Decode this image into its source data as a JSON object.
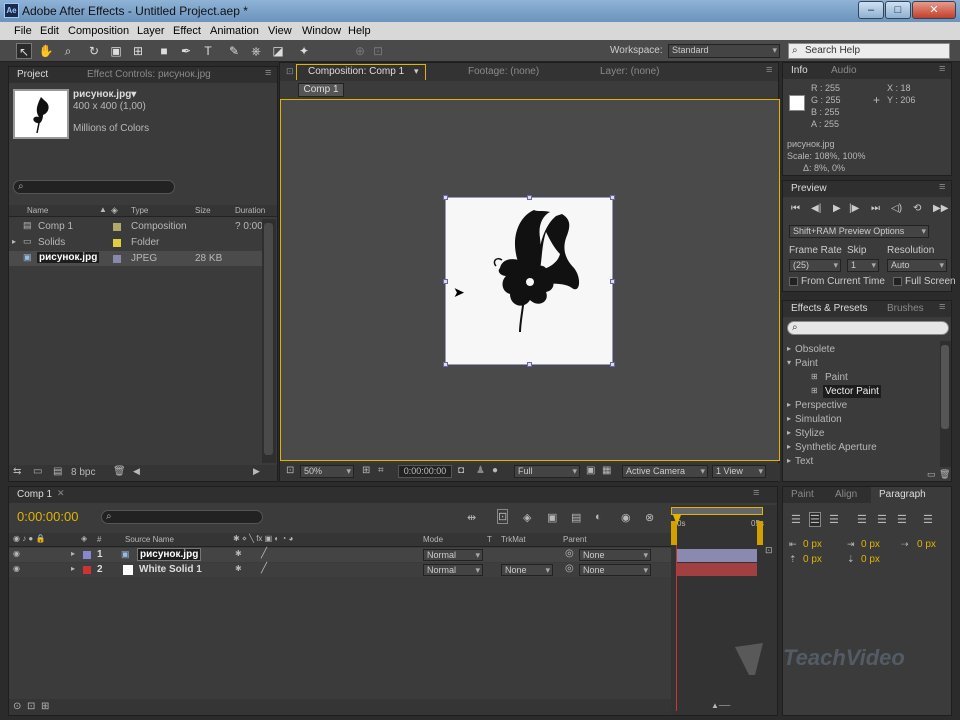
{
  "window": {
    "title": "Adobe After Effects - Untitled Project.aep *",
    "app_icon": "Ae"
  },
  "menu": [
    "File",
    "Edit",
    "Composition",
    "Layer",
    "Effect",
    "Animation",
    "View",
    "Window",
    "Help"
  ],
  "toolbar": {
    "workspace_label": "Workspace:",
    "workspace_value": "Standard",
    "search_placeholder": "Search Help",
    "search_icon": "search-icon"
  },
  "project": {
    "tabs": [
      "Project",
      "Effect Controls: рисунок.jpg"
    ],
    "thumb": {
      "name": "рисунок.jpg▾",
      "dims": "400 x 400 (1,00)",
      "colors": "Millions of Colors"
    },
    "columns": [
      "Name",
      "Type",
      "Size",
      "Duration"
    ],
    "items": [
      {
        "name": "Comp 1",
        "type": "Composition",
        "size": "",
        "duration": "? 0:00",
        "color": "#b3a96a"
      },
      {
        "name": "Solids",
        "type": "Folder",
        "size": "",
        "duration": "",
        "color": "#e0d040"
      },
      {
        "name": "рисунок.jpg",
        "type": "JPEG",
        "size": "28 KB",
        "duration": "",
        "color": "#8888aa"
      }
    ],
    "bpc": "8 bpc"
  },
  "comp": {
    "tabs": [
      "Composition: Comp 1",
      "Footage: (none)",
      "Layer: (none)"
    ],
    "breadcrumb": "Comp 1",
    "zoom": "50%",
    "timecode": "0:00:00:00",
    "resolution": "Full",
    "camera": "Active Camera",
    "view": "1 View"
  },
  "info": {
    "tabs": [
      "Info",
      "Audio"
    ],
    "r": "R : 255",
    "g": "G : 255",
    "b": "B : 255",
    "a": "A : 255",
    "x": "X : 18",
    "y": "Y : 206",
    "file": "рисунок.jpg",
    "scale": "Scale: 108%, 100%",
    "delta": "Δ: 8%, 0%"
  },
  "preview": {
    "tab": "Preview",
    "options": "Shift+RAM Preview Options",
    "frame_rate_label": "Frame Rate",
    "skip_label": "Skip",
    "resolution_label": "Resolution",
    "frame_rate": "(25)",
    "skip": "1",
    "resolution": "Auto",
    "from_current": "From Current Time",
    "full_screen": "Full Screen"
  },
  "effects": {
    "tabs": [
      "Effects & Presets",
      "Brushes"
    ],
    "items": [
      {
        "label": "Obsolete",
        "level": 0,
        "arrow": "▸"
      },
      {
        "label": "Paint",
        "level": 0,
        "arrow": "▾"
      },
      {
        "label": "Paint",
        "level": 1,
        "arrow": ""
      },
      {
        "label": "Vector Paint",
        "level": 1,
        "arrow": "",
        "selected": true
      },
      {
        "label": "Perspective",
        "level": 0,
        "arrow": "▸"
      },
      {
        "label": "Simulation",
        "level": 0,
        "arrow": "▸"
      },
      {
        "label": "Stylize",
        "level": 0,
        "arrow": "▸"
      },
      {
        "label": "Synthetic Aperture",
        "level": 0,
        "arrow": "▸"
      },
      {
        "label": "Text",
        "level": 0,
        "arrow": "▸"
      }
    ]
  },
  "paragraph": {
    "tabs": [
      "Paint",
      "Align",
      "Paragraph"
    ],
    "px": [
      "0 px",
      "0 px",
      "0 px",
      "0 px",
      "0 px"
    ]
  },
  "timeline": {
    "tab": "Comp 1",
    "timecode": "0:00:00:00",
    "columns": [
      "Source Name",
      "Mode",
      "T",
      "TrkMat",
      "Parent"
    ],
    "ruler": [
      "0s",
      "05s"
    ],
    "layers": [
      {
        "num": "1",
        "name": "рисунок.jpg",
        "mode": "Normal",
        "trkmat": "",
        "parent": "None",
        "color": "#8888cc"
      },
      {
        "num": "2",
        "name": "White Solid 1",
        "mode": "Normal",
        "trkmat": "None",
        "parent": "None",
        "color": "#cc3333"
      }
    ]
  },
  "watermark": "TeachVideo",
  "colors": {
    "accent": "#e0b400",
    "timeline_bar1": "#8a8ab0",
    "timeline_bar2": "#a04040"
  }
}
